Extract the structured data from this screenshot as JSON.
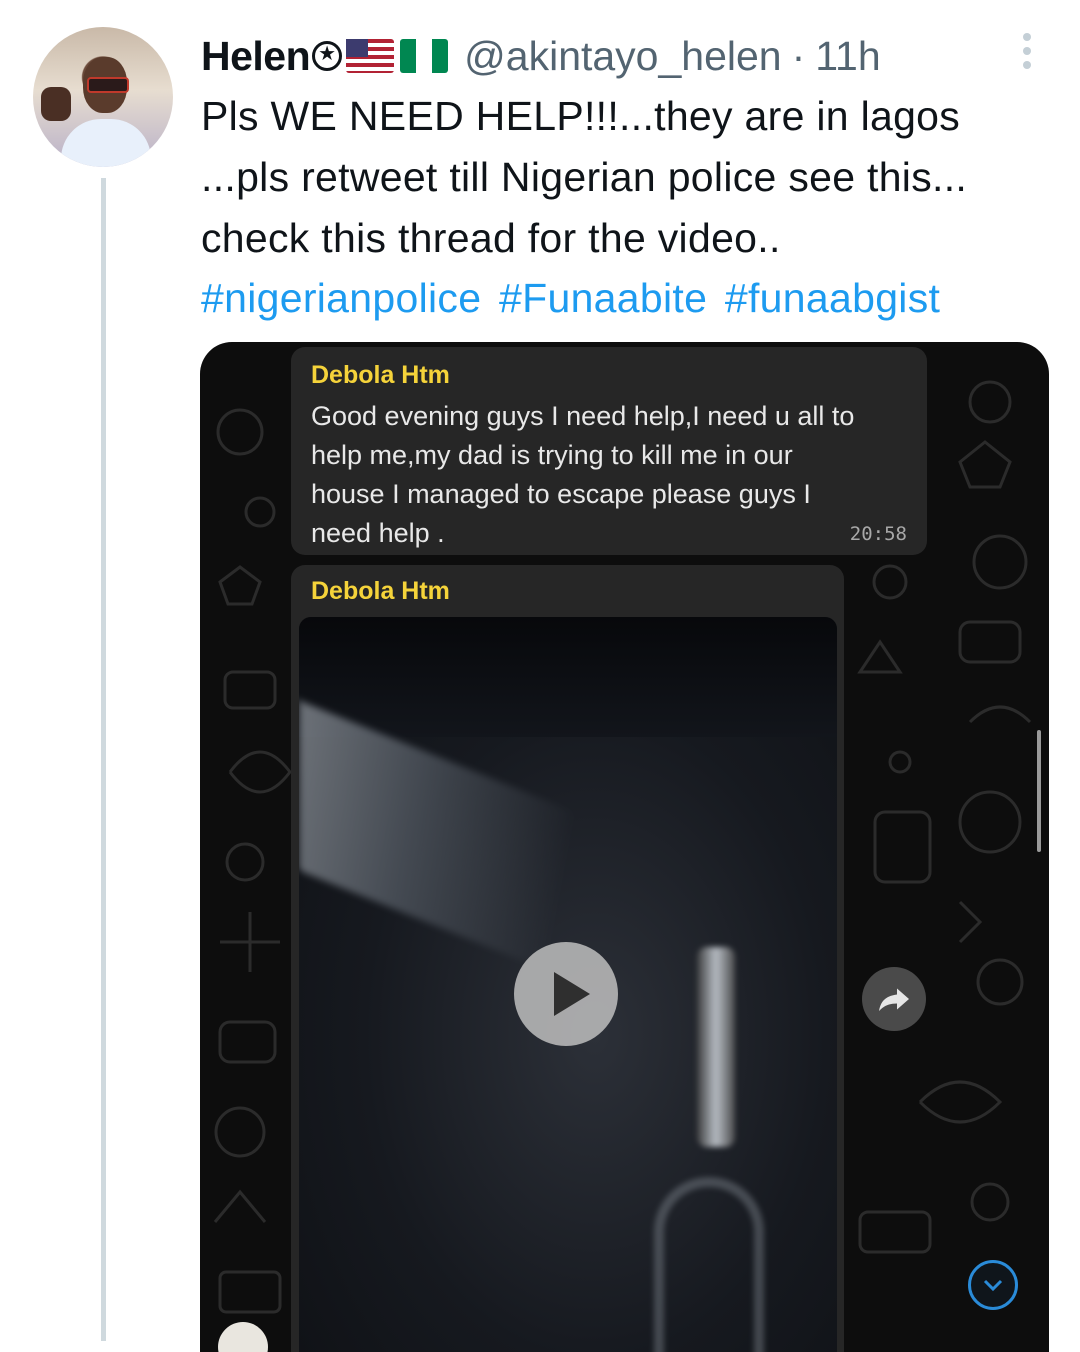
{
  "tweet": {
    "author_name": "Helen",
    "handle": "@akintayo_helen",
    "separator": "·",
    "time": "11h",
    "text_lines": [
      "Pls WE NEED HELP!!!...they are in lagos",
      "...pls retweet till Nigerian police see this...",
      "check this thread for the video.."
    ],
    "hashtags": [
      "#nigerianpolice",
      "#Funaabite",
      "#funaabgist"
    ],
    "colors": {
      "hashtag": "#1d9bf0",
      "secondary_text": "#536471"
    },
    "icons": [
      "star-badge-icon",
      "us-flag-icon",
      "nigeria-flag-icon",
      "more-options-icon"
    ]
  },
  "screenshot": {
    "message1": {
      "sender": "Debola Htm",
      "lines": [
        "Good evening guys I need help,I need u all to",
        "help me,my dad is  trying to kill me in our",
        "house I managed to escape please guys I",
        "need help ."
      ],
      "time": "20:58"
    },
    "message2": {
      "sender": "Debola Htm",
      "media": "video"
    },
    "colors": {
      "sender_name": "#f5d33a",
      "bubble": "#262626",
      "background": "#0d0d0d"
    },
    "icons": [
      "play-icon",
      "forward-icon",
      "scroll-down-icon"
    ]
  }
}
